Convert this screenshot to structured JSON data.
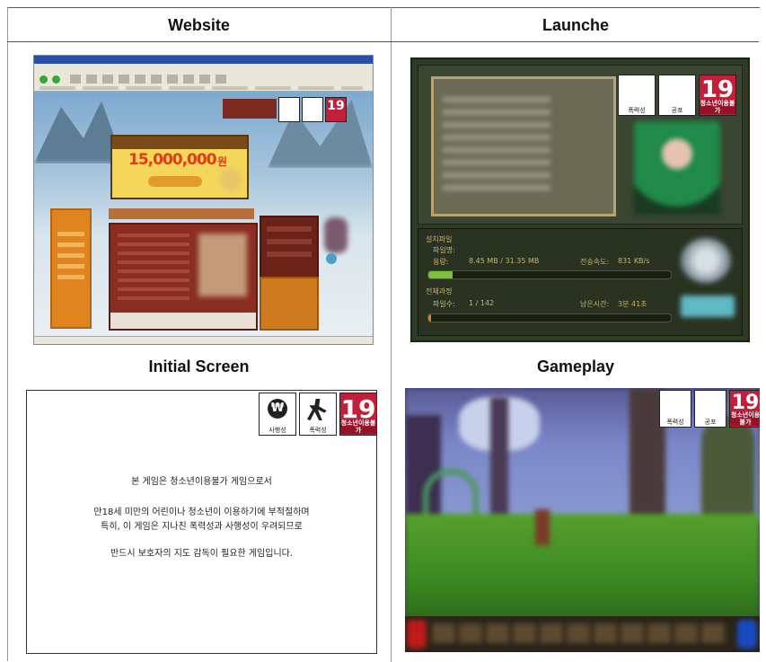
{
  "headers": {
    "website": "Website",
    "launcher": "Launche",
    "initial": "Initial Screen",
    "gameplay": "Gameplay"
  },
  "rating_icons": {
    "coin_label": "사행성",
    "violence_label": "폭력성",
    "fear_label": "공포",
    "age": "19",
    "age_label": "청소년이용불가"
  },
  "website": {
    "promo_amount": "15,000,000",
    "promo_suffix": "원"
  },
  "launcher": {
    "file_section": "설치파일",
    "file_name_label": "파일명:",
    "size_label": "용량:",
    "size_value": "8.45 MB / 31.35 MB",
    "speed_label": "전송속도:",
    "speed_value": "831 KB/s",
    "total_section": "전체과정",
    "count_label": "파일수:",
    "count_value": "1 / 142",
    "remaining_label": "남은시간:",
    "remaining_value": "3분 41초",
    "file_progress": 0.1,
    "total_progress": 0.01
  },
  "initial_screen": {
    "line1": "본 게임은 청소년이용불가 게임으로서",
    "line2": "만18세 미만의 어린이나 청소년이 이용하기에 부적절하며",
    "line3": "특히, 이 게임은 지나친 폭력성과 사행성이 우려되므로",
    "line4": "반드시 보호자의 지도 감독이 필요한 게임입니다."
  },
  "colors": {
    "rating_red": "#c2203a",
    "progress_green": "#7bc23a",
    "progress_orange": "#e8801a"
  }
}
